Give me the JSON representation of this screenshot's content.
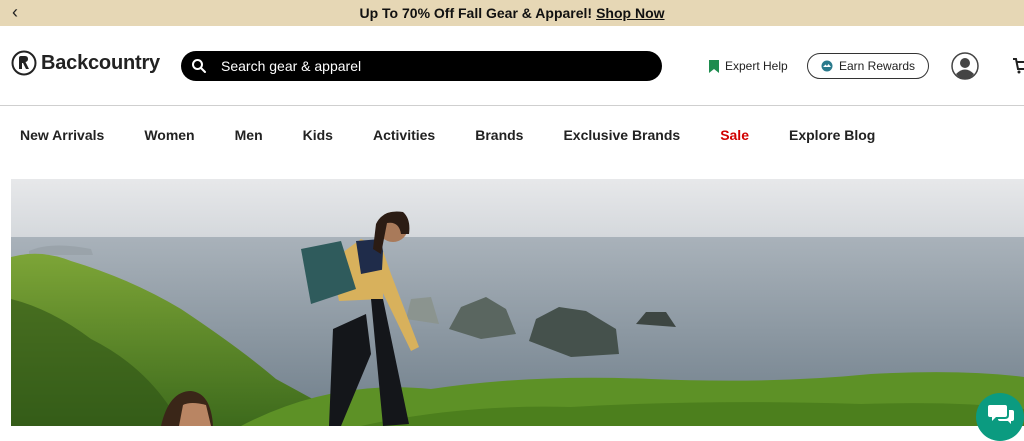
{
  "promo": {
    "text": "Up To 70% Off Fall Gear & Apparel!",
    "link": "Shop Now",
    "back_icon": "chevron-left-icon"
  },
  "header": {
    "logo_text": "Backcountry",
    "search_placeholder": "Search gear & apparel",
    "expert_help": "Expert Help",
    "earn_rewards": "Earn Rewards",
    "account_icon": "user-icon",
    "cart_icon": "cart-icon"
  },
  "nav": {
    "items": [
      {
        "label": "New Arrivals"
      },
      {
        "label": "Women"
      },
      {
        "label": "Men"
      },
      {
        "label": "Kids"
      },
      {
        "label": "Activities"
      },
      {
        "label": "Brands"
      },
      {
        "label": "Exclusive Brands"
      },
      {
        "label": "Sale",
        "color": "#d10000"
      },
      {
        "label": "Explore Blog"
      }
    ]
  },
  "colors": {
    "promo_bg": "#e6d7b5",
    "sale": "#d10000",
    "chat_button": "#0b9b80",
    "expert_flag": "#1e8c4e"
  },
  "hero": {
    "image_alt": "hiker with backpack on green coastal cliff above sea"
  }
}
